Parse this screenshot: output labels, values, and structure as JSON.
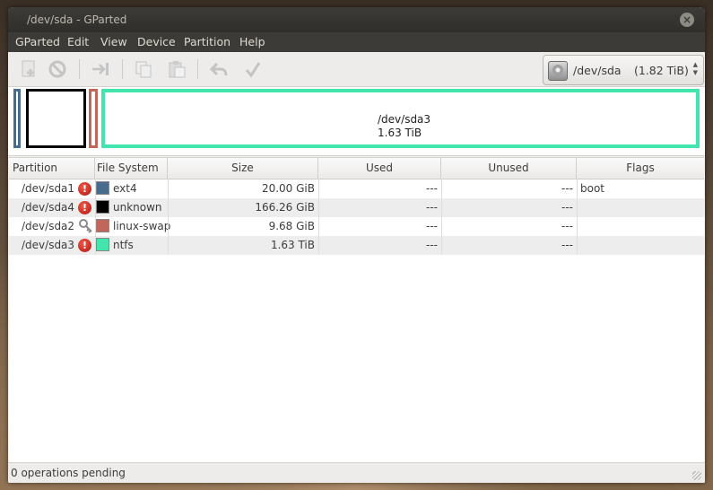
{
  "window": {
    "title": "/dev/sda - GParted"
  },
  "menu": [
    "GParted",
    "Edit",
    "View",
    "Device",
    "Partition",
    "Help"
  ],
  "toolbar": {
    "icons": [
      "new-partition-icon",
      "delete-icon",
      "resize-move-icon",
      "copy-icon",
      "paste-icon",
      "undo-icon",
      "apply-icon"
    ],
    "device": {
      "name": "/dev/sda",
      "size": "(1.82 TiB)"
    }
  },
  "diskmap": {
    "selected_partition": {
      "name": "/dev/sda3",
      "size": "1.63 TiB"
    },
    "colors": {
      "ext4": "#4a6c8c",
      "unknown": "#000000",
      "linux-swap": "#c1665a",
      "ntfs": "#42e5ac"
    }
  },
  "table": {
    "headers": [
      "Partition",
      "File System",
      "Size",
      "Used",
      "Unused",
      "Flags"
    ],
    "rows": [
      {
        "partition": "/dev/sda1",
        "status": "warning",
        "fs": "ext4",
        "color": "#4a6c8c",
        "size": "20.00 GiB",
        "used": "---",
        "unused": "---",
        "flags": "boot"
      },
      {
        "partition": "/dev/sda4",
        "status": "warning",
        "fs": "unknown",
        "color": "#000000",
        "size": "166.26 GiB",
        "used": "---",
        "unused": "---",
        "flags": ""
      },
      {
        "partition": "/dev/sda2",
        "status": "key",
        "fs": "linux-swap",
        "color": "#c1665a",
        "size": "9.68 GiB",
        "used": "---",
        "unused": "---",
        "flags": ""
      },
      {
        "partition": "/dev/sda3",
        "status": "warning",
        "fs": "ntfs",
        "color": "#42e5ac",
        "size": "1.63 TiB",
        "used": "---",
        "unused": "---",
        "flags": ""
      }
    ]
  },
  "status": {
    "text": "0 operations pending"
  }
}
